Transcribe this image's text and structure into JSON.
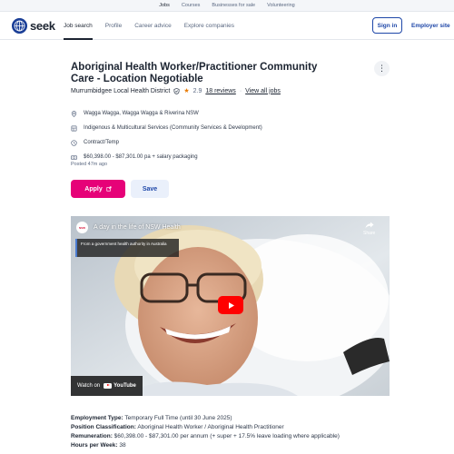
{
  "topbar": {
    "links": [
      "Jobs",
      "Courses",
      "Businesses for sale",
      "Volunteering"
    ]
  },
  "nav": {
    "brand": "seek",
    "links": [
      "Job search",
      "Profile",
      "Career advice",
      "Explore companies"
    ],
    "signin": "Sign in",
    "employer": "Employer site"
  },
  "job": {
    "title": "Aboriginal Health Worker/Practitioner Community Care - Location Negotiable",
    "company": "Murrumbidgee Local Health District",
    "rating": "2.9",
    "reviews": "18 reviews",
    "view_jobs": "View all jobs",
    "location": "Wagga Wagga, Wagga Wagga & Riverina NSW",
    "category": "Indigenous & Multicultural Services (Community Services & Development)",
    "work_type": "Contract/Temp",
    "salary": "$60,398.00 - $87,301.00 pa + salary packaging",
    "posted": "Posted 47m ago",
    "apply_label": "Apply",
    "save_label": "Save"
  },
  "video": {
    "title": "A day in the life of NSW Health",
    "badge": "NSW",
    "share": "Share",
    "info": "From a government health authority in Australia",
    "watch_on": "Watch on",
    "platform": "YouTube"
  },
  "description": [
    {
      "label": "Employment Type:",
      "value": " Temporary Full Time (until 30 June 2025)"
    },
    {
      "label": "Position Classification:",
      "value": " Aboriginal Health Worker / Aboriginal Health Practitioner"
    },
    {
      "label": "Remuneration:",
      "value": " $60,398.00 - $87,301.00 per annum (+ super + 17.5% leave loading where applicable)"
    },
    {
      "label": "Hours per Week:",
      "value": " 38"
    }
  ],
  "colors": {
    "apply": "#e60278",
    "brand_blue": "#1e47a8",
    "star": "#e87a00"
  }
}
